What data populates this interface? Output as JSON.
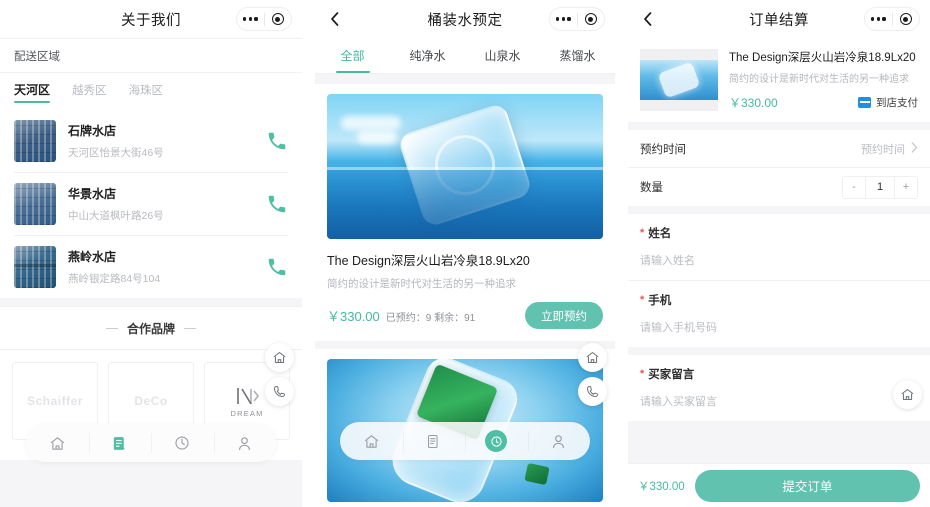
{
  "panel1": {
    "nav": {
      "title": "关于我们",
      "capsule_more": "more-options",
      "capsule_target": "mini-program-target"
    },
    "section_title": "配送区域",
    "districts": [
      {
        "label": "天河区",
        "active": true
      },
      {
        "label": "越秀区",
        "active": false
      },
      {
        "label": "海珠区",
        "active": false
      }
    ],
    "stores": [
      {
        "name": "石牌水店",
        "address": "天河区怡景大街46号"
      },
      {
        "name": "华景水店",
        "address": "中山大道枫叶路26号"
      },
      {
        "name": "燕岭水店",
        "address": "燕岭银定路84号104"
      }
    ],
    "brand_section_title": "合作品牌",
    "brands": [
      {
        "label": "Schaiffer"
      },
      {
        "label": "DeCo"
      },
      {
        "label": "DREAM"
      }
    ],
    "tabbar": [
      {
        "icon": "home-icon",
        "active": false
      },
      {
        "icon": "order-icon",
        "active": true
      },
      {
        "icon": "clock-icon",
        "active": false
      },
      {
        "icon": "person-icon",
        "active": false
      }
    ],
    "fabs": [
      {
        "icon": "home-icon"
      },
      {
        "icon": "phone-icon"
      }
    ]
  },
  "panel2": {
    "nav": {
      "title": "桶装水预定",
      "back": "back-icon"
    },
    "categories": [
      {
        "label": "全部",
        "active": true
      },
      {
        "label": "纯净水",
        "active": false
      },
      {
        "label": "山泉水",
        "active": false
      },
      {
        "label": "蒸馏水",
        "active": false
      }
    ],
    "products": [
      {
        "title": "The Design深层火山岩冷泉18.9Lx20",
        "subtitle": "简约的设计是新时代对生活的另一种追求",
        "price": "￥330.00",
        "stock": "已预约：9 剩余：91",
        "button": "立即预约"
      }
    ],
    "tabbar": [
      {
        "icon": "home-icon",
        "active": false
      },
      {
        "icon": "order-icon",
        "active": false
      },
      {
        "icon": "clock-icon",
        "active": true
      },
      {
        "icon": "person-icon",
        "active": false
      }
    ],
    "fabs": [
      {
        "icon": "home-icon"
      },
      {
        "icon": "phone-icon"
      }
    ]
  },
  "panel3": {
    "nav": {
      "title": "订单结算",
      "back": "back-icon"
    },
    "order_item": {
      "title": "The Design深层火山岩冷泉18.9Lx20",
      "subtitle": "简约的设计是新时代对生活的另一种追求",
      "price": "￥330.00",
      "pay_method": "到店支付"
    },
    "rows": [
      {
        "label": "预约时间",
        "value": "预约时间",
        "type": "link"
      },
      {
        "label": "数量",
        "value": "1",
        "type": "stepper",
        "minus": "-",
        "plus": "+"
      }
    ],
    "fields": [
      {
        "label": "姓名",
        "required": "*",
        "placeholder": "请输入姓名"
      },
      {
        "label": "手机",
        "required": "*",
        "placeholder": "请输入手机号码"
      },
      {
        "label": "买家留言",
        "required": "*",
        "placeholder": "请输入买家留言"
      }
    ],
    "footer": {
      "total": "￥330.00",
      "submit": "提交订单"
    },
    "fabs": [
      {
        "icon": "home-icon"
      }
    ]
  },
  "colors": {
    "accent_teal": "#45b9a3",
    "button_teal": "#62c2b0",
    "phone_green": "#4dbfa2",
    "required_red": "#ef5350",
    "pay_blue": "#1f8fe0",
    "bg_gray": "#f5f5f7"
  }
}
